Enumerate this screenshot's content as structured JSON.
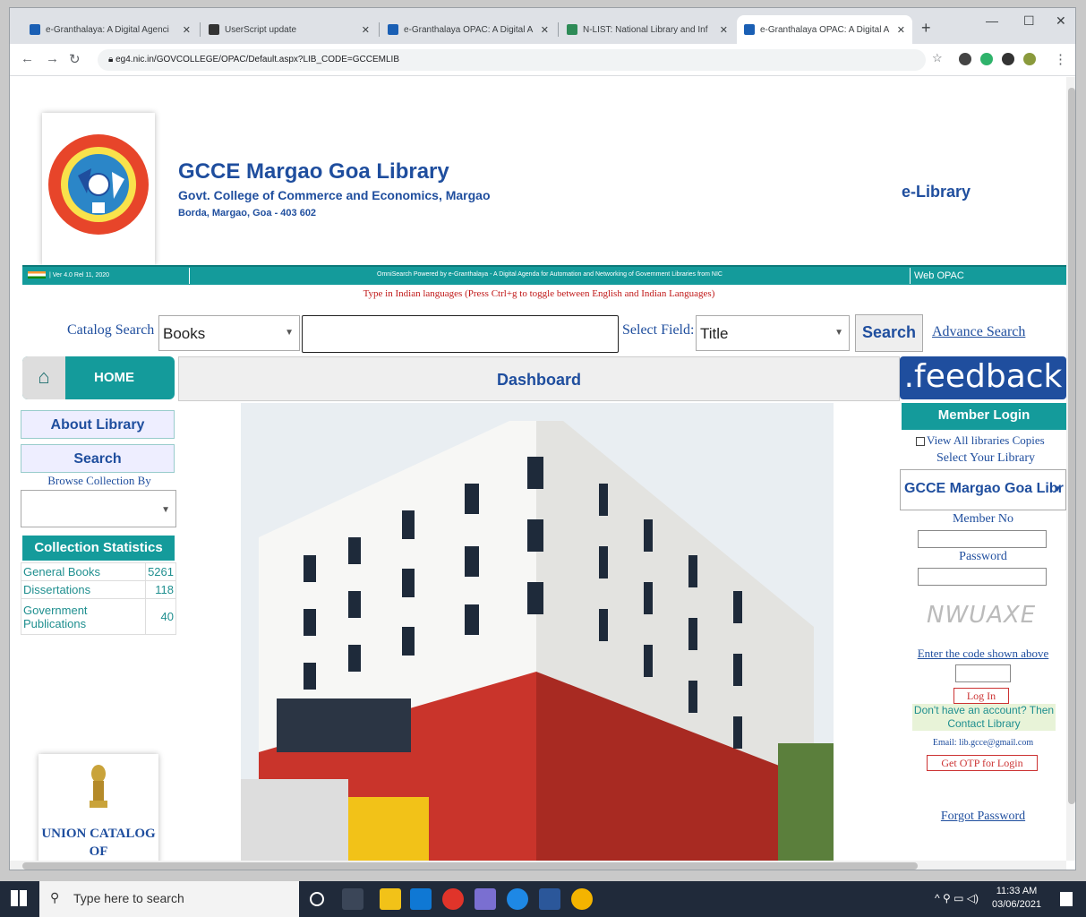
{
  "browser": {
    "tabs": [
      {
        "title": "e-Granthalaya: A Digital Agenci",
        "favicon": "#1a5fb4",
        "active": false
      },
      {
        "title": "UserScript update",
        "favicon": "#333333",
        "active": false
      },
      {
        "title": "e-Granthalaya OPAC: A Digital A",
        "favicon": "#1a5fb4",
        "active": false
      },
      {
        "title": "N-LIST: National Library and Inf",
        "favicon": "#2e8b57",
        "active": false
      },
      {
        "title": "e-Granthalaya OPAC: A Digital A",
        "favicon": "#1a5fb4",
        "active": true
      }
    ],
    "url": "eg4.nic.in/GOVCOLLEGE/OPAC/Default.aspx?LIB_CODE=GCCEMLIB"
  },
  "header": {
    "title": "GCCE Margao Goa Library",
    "subtitle": "Govt. College of Commerce and Economics, Margao",
    "address": "Borda, Margao, Goa - 403 602",
    "elibrary": "e-Library"
  },
  "band": {
    "version": "| Ver 4.0 Rel 11, 2020",
    "powered": "OmniSearch Powered by e-Granthalaya - A Digital Agenda for Automation and Networking of Government Libraries from NIC",
    "webopac": "Web OPAC"
  },
  "typein_note": "Type in Indian languages (Press Ctrl+g to toggle between English and Indian Languages)",
  "search": {
    "catalog_label": "Catalog Search",
    "catalog_value": "Books",
    "query": "",
    "field_label": "Select Field:",
    "field_value": "Title",
    "button": "Search",
    "advance": "Advance Search"
  },
  "nav": {
    "home": "HOME",
    "about": "About Library",
    "search": "Search",
    "browse_label": "Browse Collection By",
    "browse_value": ""
  },
  "dashboard": "Dashboard",
  "feedback": ".feedback",
  "stats": {
    "title": "Collection Statistics",
    "rows": [
      {
        "label": "General Books",
        "count": "5261"
      },
      {
        "label": "Dissertations",
        "count": "118"
      },
      {
        "label": "Government Publications",
        "count": "40"
      }
    ]
  },
  "union_catalog": [
    "UNION CATALOG",
    "OF GOVERNMENT"
  ],
  "login": {
    "title": "Member Login",
    "view_all": "View All libraries Copies",
    "select_library": "Select Your Library",
    "library_value": "GCCE Margao Goa Libr",
    "member_no": "Member No",
    "password": "Password",
    "captcha": "NWUAXE",
    "enter_code": "Enter the code shown above",
    "login_btn": "Log In",
    "no_account": "Don't have an account? Then Contact Library",
    "email": "Email: lib.gcce@gmail.com",
    "otp_btn": "Get OTP for Login",
    "forgot": "Forgot Password"
  },
  "taskbar": {
    "search_placeholder": "Type here to search",
    "time": "11:33 AM",
    "date": "03/06/2021"
  }
}
